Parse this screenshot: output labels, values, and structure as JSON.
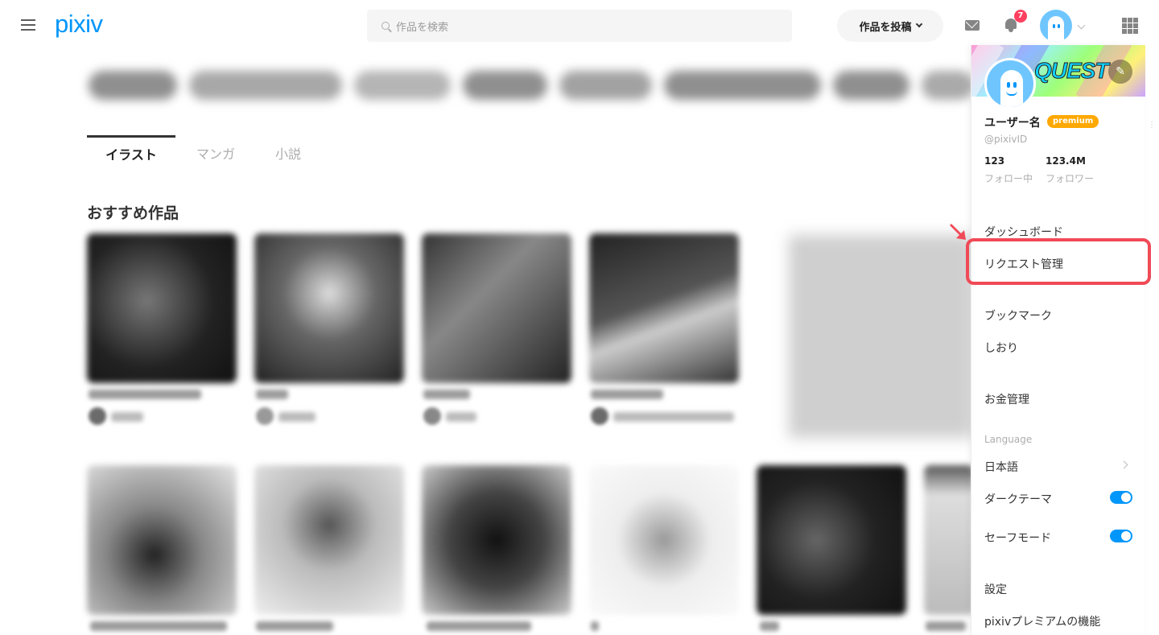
{
  "header": {
    "logo": "pixiv",
    "search_placeholder": "作品を検索",
    "post_button": "作品を投稿",
    "notification_count": "7"
  },
  "tabs": [
    {
      "label": "イラスト",
      "active": true
    },
    {
      "label": "マンガ",
      "active": false
    },
    {
      "label": "小説",
      "active": false
    }
  ],
  "section_title": "おすすめ作品",
  "profile": {
    "cover_text": "QUEST",
    "username": "ユーザー名",
    "premium_badge": "premium",
    "pixiv_id": "@pixivID",
    "following_count": "123",
    "following_label": "フォロー中",
    "followers_count": "123.4M",
    "followers_label": "フォロワー"
  },
  "menu": {
    "dashboard": "ダッシュボード",
    "request": "リクエスト管理",
    "bookmarks": "ブックマーク",
    "shiori": "しおり",
    "money": "お金管理",
    "language_label": "Language",
    "language_value": "日本語",
    "dark_theme": "ダークテーマ",
    "safe_mode": "セーフモード",
    "settings": "設定",
    "premium_features": "pixivプレミアムの機能"
  },
  "toggles": {
    "dark_theme_on": true,
    "safe_mode_on": true
  },
  "colors": {
    "accent": "#0096fa",
    "highlight": "#f04a57",
    "premium": "#ffa800",
    "badge": "#ff4060"
  }
}
